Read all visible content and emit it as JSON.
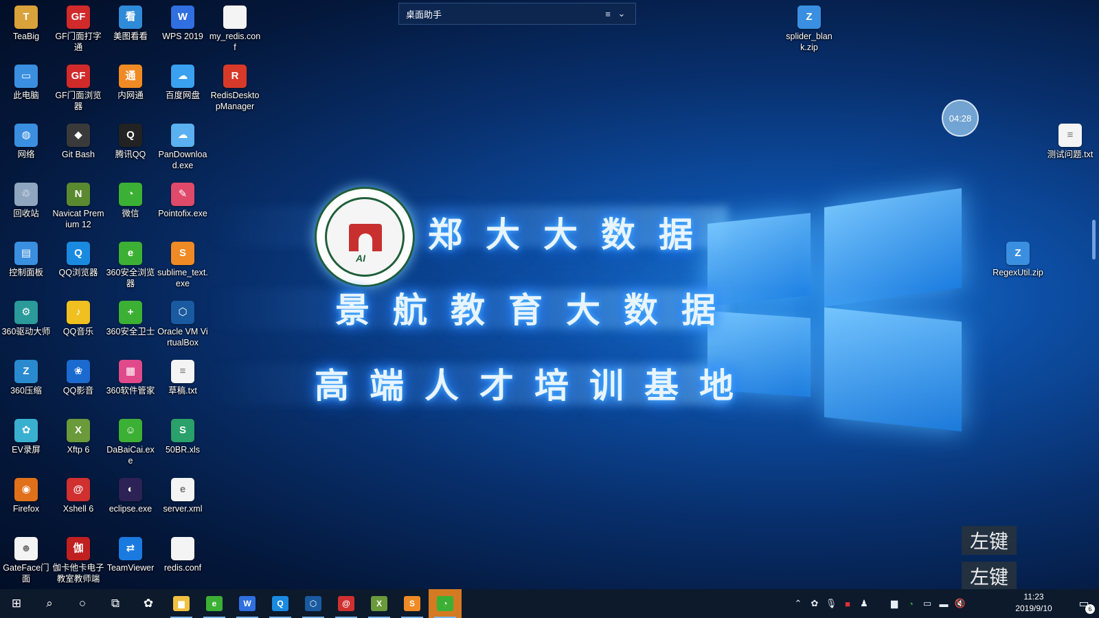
{
  "desktop": {
    "icons": [
      {
        "label": "TeaBig",
        "icon": "folder-user-icon",
        "color": "#d9a23a",
        "glyph": "T"
      },
      {
        "label": "GF门面打字通",
        "icon": "gf-typing-icon",
        "color": "#d12a2a",
        "glyph": "GF"
      },
      {
        "label": "美图看看",
        "icon": "meitu-viewer-icon",
        "color": "#2f8ad8",
        "glyph": "看"
      },
      {
        "label": "WPS 2019",
        "icon": "wps-icon",
        "color": "#2f6fe0",
        "glyph": "W"
      },
      {
        "label": "my_redis.conf",
        "icon": "file-icon",
        "color": "#f4f4f4",
        "glyph": ""
      },
      {
        "label": "此电脑",
        "icon": "computer-icon",
        "color": "#3a8fe0",
        "glyph": "▭"
      },
      {
        "label": "GF门面浏览器",
        "icon": "gf-browser-icon",
        "color": "#d12a2a",
        "glyph": "GF"
      },
      {
        "label": "内网通",
        "icon": "intranet-icon",
        "color": "#f08a24",
        "glyph": "通"
      },
      {
        "label": "百度网盘",
        "icon": "baidu-netdisk-icon",
        "color": "#3aa0f0",
        "glyph": "☁"
      },
      {
        "label": "RedisDesktopManager",
        "icon": "redis-icon",
        "color": "#d83a2a",
        "glyph": "R"
      },
      {
        "label": "网络",
        "icon": "network-icon",
        "color": "#3a8fe0",
        "glyph": "◍"
      },
      {
        "label": "Git Bash",
        "icon": "git-bash-icon",
        "color": "#3a3a3a",
        "glyph": "◆"
      },
      {
        "label": "腾讯QQ",
        "icon": "qq-icon",
        "color": "#222222",
        "glyph": "Q"
      },
      {
        "label": "PanDownload.exe",
        "icon": "pandownload-icon",
        "color": "#5ab0f0",
        "glyph": "☁"
      },
      {
        "label": "回收站",
        "icon": "recycle-bin-icon",
        "color": "#8fa6c0",
        "glyph": "♲"
      },
      {
        "label": "Navicat Premium 12",
        "icon": "navicat-icon",
        "color": "#5a8a30",
        "glyph": "N"
      },
      {
        "label": "微信",
        "icon": "wechat-icon",
        "color": "#3cb034",
        "glyph": "◔"
      },
      {
        "label": "Pointofix.exe",
        "icon": "pointofix-icon",
        "color": "#e04a6a",
        "glyph": "✎"
      },
      {
        "label": "控制面板",
        "icon": "control-panel-icon",
        "color": "#3a8fe0",
        "glyph": "▤"
      },
      {
        "label": "QQ浏览器",
        "icon": "qq-browser-icon",
        "color": "#1a8ae0",
        "glyph": "Q"
      },
      {
        "label": "360安全浏览器",
        "icon": "360-browser-icon",
        "color": "#3cb034",
        "glyph": "e"
      },
      {
        "label": "sublime_text.exe",
        "icon": "sublime-icon",
        "color": "#f08a24",
        "glyph": "S"
      },
      {
        "label": "360驱动大师",
        "icon": "360-driver-icon",
        "color": "#2a9a9a",
        "glyph": "⚙"
      },
      {
        "label": "QQ音乐",
        "icon": "qq-music-icon",
        "color": "#f0c020",
        "glyph": "♪"
      },
      {
        "label": "360安全卫士",
        "icon": "360-guard-icon",
        "color": "#3cb034",
        "glyph": "+"
      },
      {
        "label": "Oracle VM VirtualBox",
        "icon": "virtualbox-icon",
        "color": "#1a5aa0",
        "glyph": "⬡"
      },
      {
        "label": "360压缩",
        "icon": "360-zip-icon",
        "color": "#2a8ad0",
        "glyph": "Z"
      },
      {
        "label": "QQ影音",
        "icon": "qq-player-icon",
        "color": "#1a6ad0",
        "glyph": "❀"
      },
      {
        "label": "360软件管家",
        "icon": "360-software-icon",
        "color": "#e04a8a",
        "glyph": "▦"
      },
      {
        "label": "草稿.txt",
        "icon": "text-file-icon",
        "color": "#f4f4f4",
        "glyph": "≡"
      },
      {
        "label": "EV录屏",
        "icon": "ev-recorder-icon",
        "color": "#3ab0d0",
        "glyph": "✿"
      },
      {
        "label": "Xftp 6",
        "icon": "xftp-icon",
        "color": "#6a9a3a",
        "glyph": "X"
      },
      {
        "label": "DaBaiCai.exe",
        "icon": "dabaicai-icon",
        "color": "#3cb034",
        "glyph": "☺"
      },
      {
        "label": "50BR.xls",
        "icon": "spreadsheet-icon",
        "color": "#2aa06a",
        "glyph": "S"
      },
      {
        "label": "Firefox",
        "icon": "firefox-icon",
        "color": "#e0701a",
        "glyph": "◉"
      },
      {
        "label": "Xshell 6",
        "icon": "xshell-icon",
        "color": "#d03030",
        "glyph": "@"
      },
      {
        "label": "eclipse.exe",
        "icon": "eclipse-icon",
        "color": "#2c2255",
        "glyph": "◐"
      },
      {
        "label": "server.xml",
        "icon": "xml-file-icon",
        "color": "#f4f4f4",
        "glyph": "e"
      },
      {
        "label": "GateFace门面",
        "icon": "gateface-icon",
        "color": "#f4f4f4",
        "glyph": "☻"
      },
      {
        "label": "伽卡他卡电子教室教师端",
        "icon": "jiaka-classroom-icon",
        "color": "#c02020",
        "glyph": "伽"
      },
      {
        "label": "TeamViewer",
        "icon": "teamviewer-icon",
        "color": "#1a7ae0",
        "glyph": "⇄"
      },
      {
        "label": "redis.conf",
        "icon": "file-icon",
        "color": "#f4f4f4",
        "glyph": ""
      },
      {
        "label": "splider_blank.zip",
        "icon": "zip-archive-icon",
        "color": "#3a8fe0",
        "glyph": "Z"
      },
      {
        "label": "测试问题.txt",
        "icon": "text-file-icon",
        "color": "#f4f4f4",
        "glyph": "≡"
      },
      {
        "label": "RegexUtil.zip",
        "icon": "zip-archive-icon",
        "color": "#3a8fe0",
        "glyph": "Z"
      }
    ]
  },
  "helper": {
    "title": "桌面助手",
    "menu_icon": "≡",
    "chevron_icon": "⌄"
  },
  "timer": {
    "value": "04:28"
  },
  "banner": {
    "line1": "郑大大数据",
    "line2": "景航教育大数据",
    "line3": "高端人才培训基地",
    "seal_text": "AI"
  },
  "hints": [
    "左键",
    "左键"
  ],
  "taskbar": {
    "apps": [
      {
        "name": "file-explorer",
        "icon": "folder-icon",
        "color": "#f0c040",
        "glyph": "▆"
      },
      {
        "name": "360-browser",
        "icon": "360-browser-icon",
        "color": "#3cb034",
        "glyph": "e"
      },
      {
        "name": "wps",
        "icon": "wps-icon",
        "color": "#2f6fe0",
        "glyph": "W"
      },
      {
        "name": "qq-browser",
        "icon": "qq-browser-icon",
        "color": "#1a8ae0",
        "glyph": "Q"
      },
      {
        "name": "virtualbox",
        "icon": "virtualbox-icon",
        "color": "#1a5aa0",
        "glyph": "⬡"
      },
      {
        "name": "xshell",
        "icon": "xshell-icon",
        "color": "#d03030",
        "glyph": "@"
      },
      {
        "name": "xftp",
        "icon": "xftp-icon",
        "color": "#6a9a3a",
        "glyph": "X"
      },
      {
        "name": "sublime",
        "icon": "sublime-icon",
        "color": "#f08a24",
        "glyph": "S"
      },
      {
        "name": "wechat",
        "icon": "wechat-icon",
        "color": "#3cb034",
        "glyph": "◔"
      }
    ],
    "time": "11:23",
    "date": "2019/9/10",
    "notification_count": "6"
  },
  "colors": {
    "taskbar": "#0c1a2c",
    "active_app": "#d47a22",
    "accent": "#1a78d8"
  }
}
